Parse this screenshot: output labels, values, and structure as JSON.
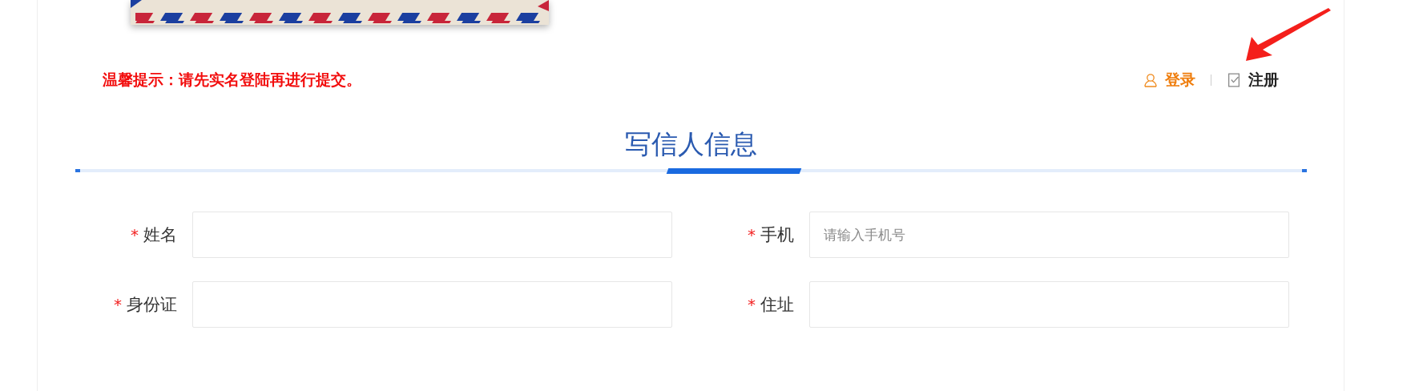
{
  "notice": "温馨提示：请先实名登陆再进行提交。",
  "auth_links": [
    {
      "kind": "login",
      "label": "登录"
    },
    {
      "kind": "register",
      "label": "注册"
    }
  ],
  "section": {
    "title": "写信人信息"
  },
  "fields": [
    {
      "mark": "*",
      "label": "姓名"
    },
    {
      "mark": "*",
      "label": "手机",
      "placeholder": "请输入手机号"
    },
    {
      "mark": "*",
      "label": "身份证"
    },
    {
      "mark": "*",
      "label": "住址"
    }
  ]
}
